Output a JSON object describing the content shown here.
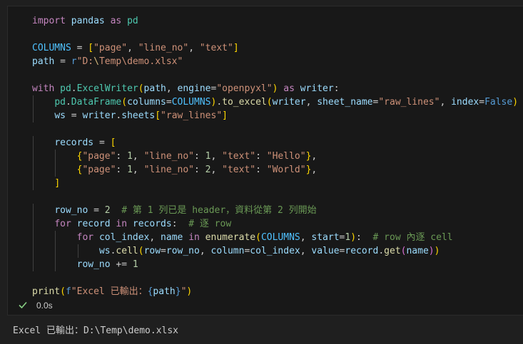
{
  "cell": {
    "code_lines": [
      "import pandas as pd",
      "",
      "COLUMNS = [\"page\", \"line_no\", \"text\"]",
      "path = r\"D:\\Temp\\demo.xlsx\"",
      "",
      "with pd.ExcelWriter(path, engine=\"openpyxl\") as writer:",
      "    pd.DataFrame(columns=COLUMNS).to_excel(writer, sheet_name=\"raw_lines\", index=False)",
      "    ws = writer.sheets[\"raw_lines\"]",
      "",
      "    records = [",
      "        {\"page\": 1, \"line_no\": 1, \"text\": \"Hello\"},",
      "        {\"page\": 1, \"line_no\": 2, \"text\": \"World\"},",
      "    ]",
      "",
      "    row_no = 2  # 第 1 列已是 header，資料從第 2 列開始",
      "    for record in records:  # 逐 row",
      "        for col_index, name in enumerate(COLUMNS, start=1):  # row 內逐 cell",
      "            ws.cell(row=row_no, column=col_index, value=record.get(name))",
      "        row_no += 1",
      "",
      "print(f\"Excel 已輸出：{path}\")"
    ],
    "status": "success",
    "exec_time": "0.0s"
  },
  "output": {
    "text": "Excel 已輸出：D:\\Temp\\demo.xlsx"
  },
  "icons": {
    "status_icon": "check-icon"
  },
  "colors": {
    "background": "#1f1f1f",
    "cell_background": "#181818",
    "success": "#89d185"
  }
}
